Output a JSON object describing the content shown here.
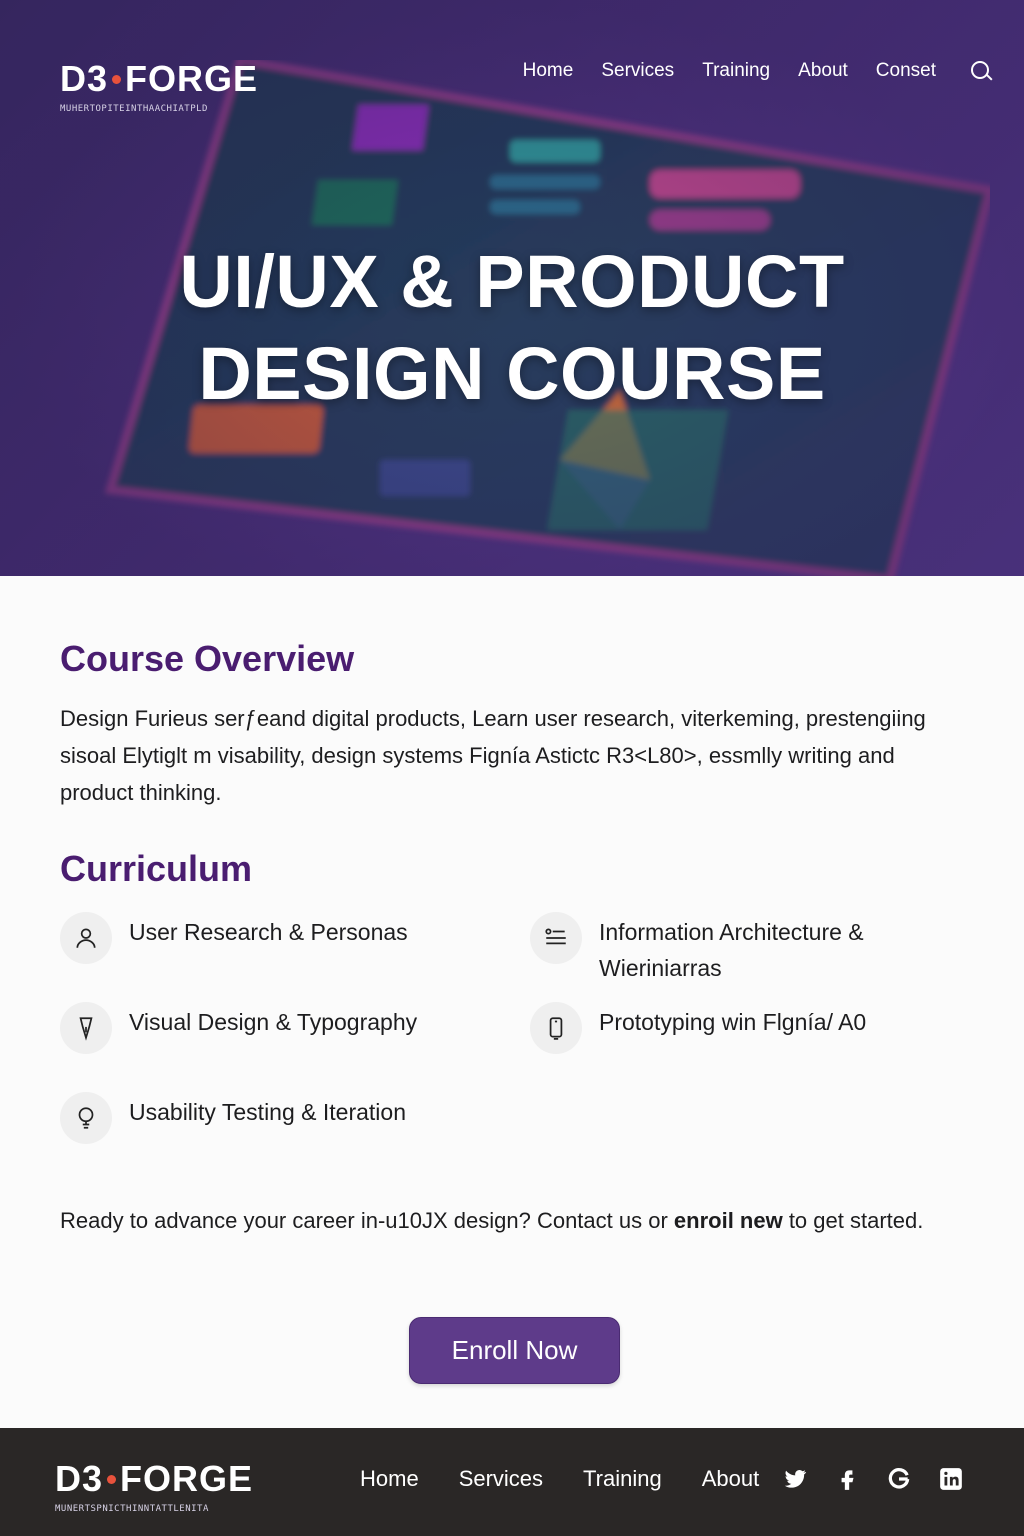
{
  "header": {
    "brand": {
      "logo_left": "D3",
      "logo_right": "FORGE",
      "tagline": "MUHERTOPITEINTHAACHIATPLD"
    },
    "nav": [
      "Home",
      "Services",
      "Training",
      "About",
      "Conset"
    ]
  },
  "hero": {
    "title_line1": "UI/UX & PRODUCT",
    "title_line2": "DESIGN COURSE"
  },
  "overview": {
    "title": "Course Overview",
    "text": "Design Furieus serƒeand digital products, Learn user research, viterkeming, prestengiing sisoal Elytiglt m visability, design systems Fignía Astictc R3<L80>, essmlly writing and product thinking."
  },
  "curriculum": {
    "title": "Curriculum",
    "items": [
      {
        "label": "User Research & Personas",
        "icon": "person-icon"
      },
      {
        "label": "Information Architecture & Wieriniarras",
        "icon": "sitemap-icon"
      },
      {
        "label": "Visual Design & Typography",
        "icon": "pen-nib-icon"
      },
      {
        "label": "Prototyping win Flgnía/ A0",
        "icon": "mobile-icon"
      },
      {
        "label": "Usability Testing & Iteration",
        "icon": "lightbulb-icon"
      }
    ]
  },
  "cta": {
    "text_before": "Ready to advance your career in-u10JX design? Contact us or ",
    "text_bold": "enroil new",
    "text_after": " to get started.",
    "button": "Enroll Now"
  },
  "footer": {
    "brand": {
      "logo_left": "D3",
      "logo_right": "FORGE",
      "tagline": "MUNERTSPNICTHINNTATTLENITA"
    },
    "nav": [
      "Home",
      "Services",
      "Training",
      "About"
    ],
    "social": [
      "twitter-icon",
      "facebook-icon",
      "google-icon",
      "linkedin-icon"
    ]
  },
  "colors": {
    "accent": "#4a1d70",
    "button": "#5e3b8a",
    "footer_bg": "#2a2726",
    "logo_dot": "#e8523c"
  }
}
